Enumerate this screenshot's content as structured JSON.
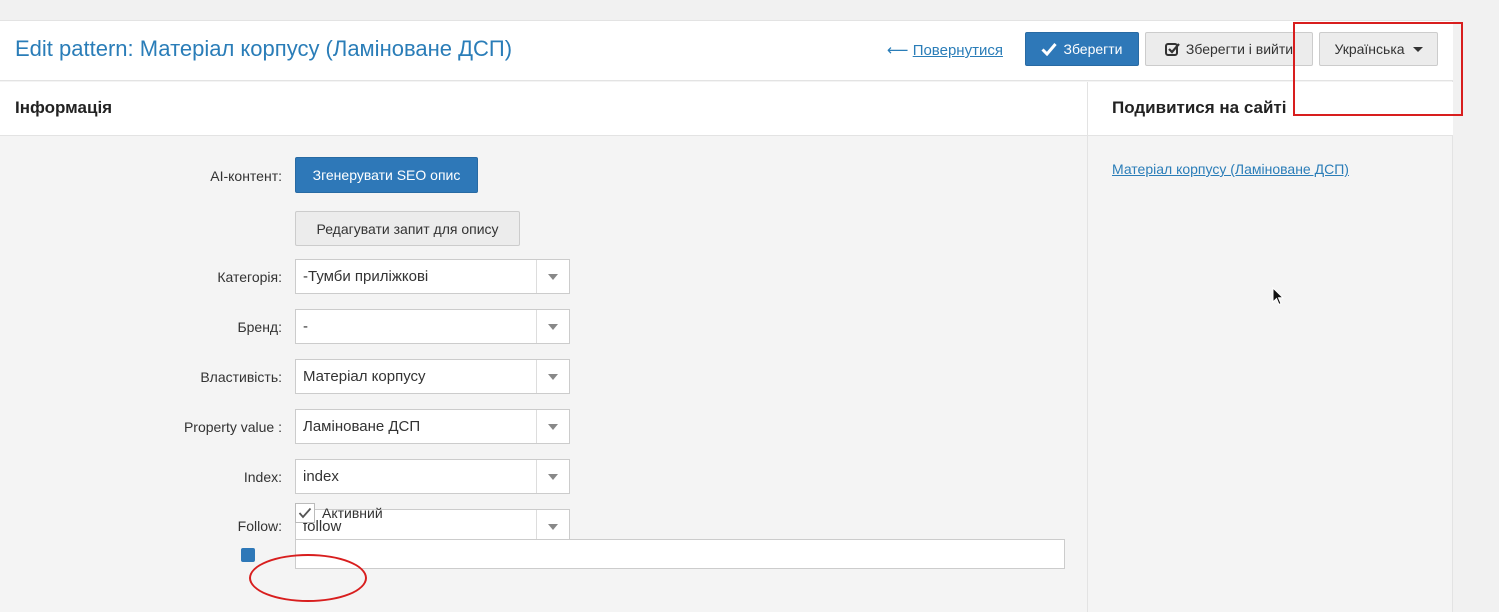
{
  "header": {
    "title": "Edit pattern: Матеріал корпусу (Ламіноване ДСП)",
    "back_arrow": "⟵",
    "back_label": "Повернутися",
    "save_label": "Зберегти",
    "save_exit_label": "Зберегти і вийти",
    "language_label": "Українська"
  },
  "info_panel": {
    "title": "Інформація",
    "ai_label": "AI-контент:",
    "generate_button": "Згенерувати SEO опис",
    "edit_prompt_button": "Редагувати запит для опису",
    "fields": [
      {
        "label": "Категорія:",
        "value": "-Тумби приліжкові"
      },
      {
        "label": "Бренд:",
        "value": "-"
      },
      {
        "label": "Властивість:",
        "value": "Матеріал корпусу"
      },
      {
        "label": "Property value :",
        "value": "Ламіноване ДСП"
      },
      {
        "label": "Index:",
        "value": "index"
      },
      {
        "label": "Follow:",
        "value": "follow"
      }
    ],
    "active_label": "Активний",
    "active_checked": true
  },
  "site_panel": {
    "title": "Подивитися на сайті",
    "link_text": "Матеріал корпусу (Ламіноване ДСП)"
  },
  "colors": {
    "accent": "#2e78b8",
    "link": "#2a7db8",
    "annotation": "#d81e1e"
  },
  "icons": {
    "save": "checkmark-icon",
    "save_exit": "checkbox-check-icon",
    "language": "caret-down-icon",
    "select": "dropdown-arrow-icon",
    "cursor": "mouse-pointer-icon"
  }
}
